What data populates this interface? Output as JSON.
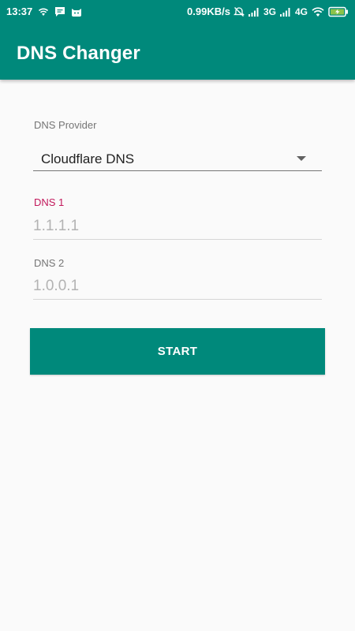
{
  "status_bar": {
    "time": "13:37",
    "net_speed": "0.99KB/s",
    "net_type_1": "3G",
    "net_type_2": "4G"
  },
  "app_bar": {
    "title": "DNS Changer"
  },
  "form": {
    "provider_label": "DNS Provider",
    "provider_selected": "Cloudflare DNS",
    "dns1_label": "DNS 1",
    "dns1_value": "1.1.1.1",
    "dns2_label": "DNS 2",
    "dns2_value": "1.0.0.1",
    "start_label": "START"
  },
  "colors": {
    "primary": "#00897b",
    "accent": "#c2185b",
    "background": "#fafafa"
  }
}
